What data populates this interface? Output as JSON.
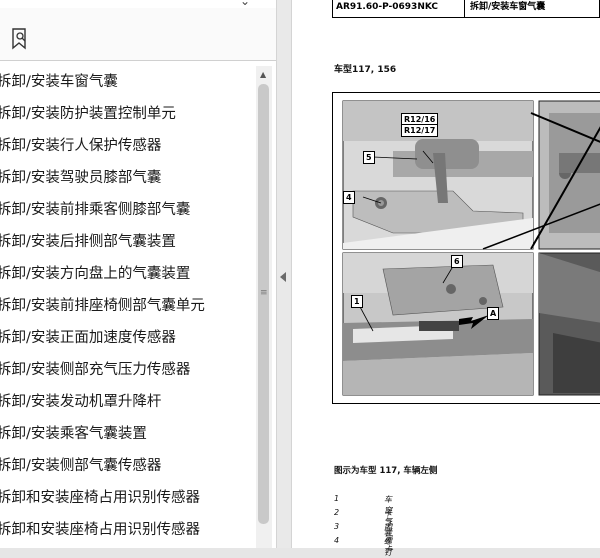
{
  "bookmarks": {
    "items": [
      {
        "label": "拆卸/安装车窗气囊"
      },
      {
        "label": "拆卸/安装防护装置控制单元"
      },
      {
        "label": "拆卸/安装行人保护传感器"
      },
      {
        "label": "拆卸/安装驾驶员膝部气囊"
      },
      {
        "label": "拆卸/安装前排乘客侧膝部气囊"
      },
      {
        "label": "拆卸/安装后排侧部气囊装置"
      },
      {
        "label": "拆卸/安装方向盘上的气囊装置"
      },
      {
        "label": "拆卸/安装前排座椅侧部气囊单元"
      },
      {
        "label": "拆卸/安装正面加速度传感器"
      },
      {
        "label": "拆卸/安装侧部充气压力传感器"
      },
      {
        "label": "拆卸/安装发动机罩升降杆"
      },
      {
        "label": "拆卸/安装乘客气囊装置"
      },
      {
        "label": "拆卸/安装侧部气囊传感器"
      },
      {
        "label": "拆卸和安装座椅占用识别传感器"
      },
      {
        "label": "拆卸和安装座椅占用识别传感器"
      }
    ]
  },
  "document": {
    "code": "AR91.60-P-0693NKC",
    "title": "拆卸/安装车窗气囊",
    "model_label": "车型117, 156",
    "figure": {
      "callouts": {
        "r12_16": "R12/16",
        "r12_17": "R12/17",
        "c5": "5",
        "c4": "4",
        "c6": "6",
        "c1": "1",
        "cA": "A"
      }
    },
    "caption": "图示为车型 117, 车辆左侧",
    "legend": [
      {
        "num": "1",
        "text": "车窗气囊"
      },
      {
        "num": "2",
        "text": "卡子"
      },
      {
        "num": "3",
        "text": "固定卡"
      },
      {
        "num": "4",
        "text": "螺钉"
      }
    ]
  },
  "colors": {
    "accent": "#c9c9c9",
    "page": "#ffffff",
    "background": "#e6e6e6"
  }
}
